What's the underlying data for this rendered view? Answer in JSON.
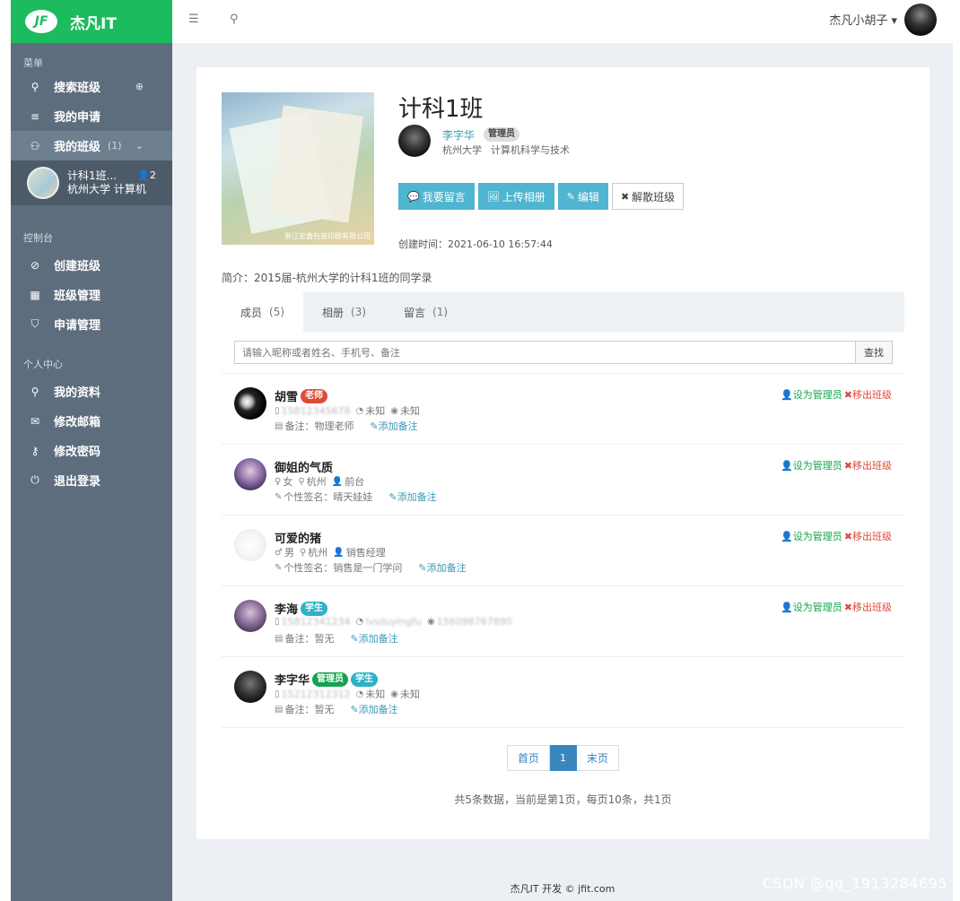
{
  "brand": {
    "logo_mark": "JF",
    "name": "杰凡IT"
  },
  "sidebar": {
    "section_menu": "菜单",
    "items_menu": [
      {
        "label": "搜索班级",
        "icon": "search-icon",
        "right": "⊕"
      },
      {
        "label": "我的申请",
        "icon": "list-icon"
      },
      {
        "label": "我的班级",
        "icon": "users-icon",
        "count": "(1)",
        "right": "⌄"
      }
    ],
    "my_class": {
      "title": "计科1班...",
      "sub": "杭州大学 计算机",
      "members": "👤2"
    },
    "section_console": "控制台",
    "items_console": [
      {
        "label": "创建班级",
        "icon": "ban-icon"
      },
      {
        "label": "班级管理",
        "icon": "grid-icon"
      },
      {
        "label": "申请管理",
        "icon": "shield-icon"
      }
    ],
    "section_personal": "个人中心",
    "items_personal": [
      {
        "label": "我的资料",
        "icon": "user-icon"
      },
      {
        "label": "修改邮箱",
        "icon": "mail-icon"
      },
      {
        "label": "修改密码",
        "icon": "key-icon"
      },
      {
        "label": "退出登录",
        "icon": "power-icon"
      }
    ]
  },
  "topbar": {
    "menu_toggle": "☰",
    "search": "⚲",
    "username": "杰凡小胡子 ▾"
  },
  "class_info": {
    "cover_caption": "浙江宏鑫包装印刷有限公司",
    "title": "计科1班",
    "owner_name": "李字华",
    "owner_role": "管理员",
    "owner_school": "杭州大学",
    "owner_major": "计算机科学与技术",
    "buttons": [
      {
        "label": "我要留言",
        "icon": "comment-icon",
        "glyph": "💬"
      },
      {
        "label": "上传相册",
        "icon": "image-icon",
        "glyph": "🖼"
      },
      {
        "label": "编辑",
        "icon": "edit-icon",
        "glyph": "✎"
      },
      {
        "label": "解散班级",
        "icon": "times-icon",
        "glyph": "✖"
      }
    ],
    "created": "创建时间：2021-06-10 16:57:44",
    "intro": "简介：2015届-杭州大学的计科1班的同学录"
  },
  "tabs": [
    {
      "label": "成员",
      "count": "(5)"
    },
    {
      "label": "相册",
      "count": "(3)"
    },
    {
      "label": "留言",
      "count": "(1)"
    }
  ],
  "search": {
    "placeholder": "请输入昵称或者姓名、手机号、备注",
    "button": "查找"
  },
  "members": [
    {
      "name": "胡雪",
      "badges": [
        {
          "text": "老师",
          "color": "red"
        }
      ],
      "line1": [
        {
          "ic": "▯",
          "text": "15812345678",
          "blur": true
        },
        {
          "ic": "◔",
          "text": "未知"
        },
        {
          "ic": "◉",
          "text": "未知"
        }
      ],
      "line2": {
        "ic": "▤",
        "text": "备注：物理老师"
      },
      "note": "✎添加备注",
      "actions": true
    },
    {
      "name": "御姐的气质",
      "badges": [],
      "line1": [
        {
          "ic": "♀",
          "text": "女"
        },
        {
          "ic": "⚲",
          "text": "杭州"
        },
        {
          "ic": "👤",
          "text": "前台"
        }
      ],
      "line2": {
        "ic": "✎",
        "text": "个性签名：晴天娃娃"
      },
      "note": "✎添加备注",
      "actions": true
    },
    {
      "name": "可爱的猪",
      "badges": [],
      "line1": [
        {
          "ic": "♂",
          "text": "男"
        },
        {
          "ic": "⚲",
          "text": "杭州"
        },
        {
          "ic": "👤",
          "text": "销售经理"
        }
      ],
      "line2": {
        "ic": "✎",
        "text": "个性签名：销售是一门学问"
      },
      "note": "✎添加备注",
      "actions": true
    },
    {
      "name": "李海",
      "badges": [
        {
          "text": "学生",
          "color": "blue"
        }
      ],
      "line1": [
        {
          "ic": "▯",
          "text": "15812341234",
          "blur": true
        },
        {
          "ic": "◔",
          "text": "lvsiluyingfu",
          "blur": true
        },
        {
          "ic": "◉",
          "text": "156098767890",
          "blur": true
        }
      ],
      "line2": {
        "ic": "▤",
        "text": "备注：暂无"
      },
      "note": "✎添加备注",
      "actions": true
    },
    {
      "name": "李字华",
      "badges": [
        {
          "text": "管理员",
          "color": "green"
        },
        {
          "text": "学生",
          "color": "blue"
        }
      ],
      "line1": [
        {
          "ic": "▯",
          "text": "15212312312",
          "blur": true
        },
        {
          "ic": "◔",
          "text": "未知"
        },
        {
          "ic": "◉",
          "text": "未知"
        }
      ],
      "line2": {
        "ic": "▤",
        "text": "备注：暂无"
      },
      "note": "✎添加备注",
      "actions": false
    }
  ],
  "member_actions": {
    "set_admin": "设为管理员",
    "remove": "移出班级"
  },
  "pager": {
    "first": "首页",
    "current": "1",
    "last": "末页"
  },
  "summary": "共5条数据，当前是第1页，每页10条，共1页",
  "footer": "杰凡IT 开发 © jfit.com",
  "watermark": "CSDN @qq_1913284695",
  "colors": {
    "brand_green": "#1cbb5e",
    "sidebar": "#5d6d7e",
    "info_button": "#4fb5d0",
    "admin_green": "#15a44c",
    "danger_red": "#dd4b39"
  }
}
